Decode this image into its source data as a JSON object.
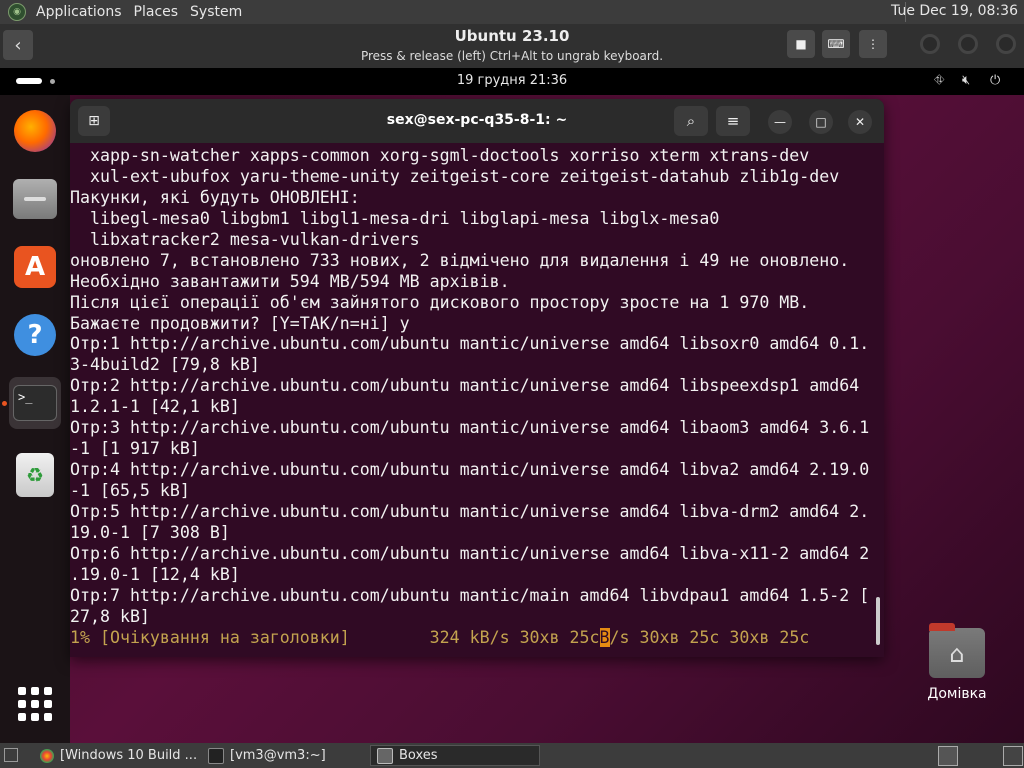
{
  "host": {
    "menus": [
      "Applications",
      "Places",
      "System"
    ],
    "clock": "Tue Dec 19, 08:36"
  },
  "boxes": {
    "title": "Ubuntu 23.10",
    "subtitle": "Press & release (left) Ctrl+Alt to ungrab keyboard."
  },
  "guest": {
    "clock": "19 грудня  21:36",
    "desktop_icon_label": "Домівка"
  },
  "terminal": {
    "title": "sex@sex-pc-q35-8-1: ~",
    "lines": [
      "  xapp-sn-watcher xapps-common xorg-sgml-doctools xorriso xterm xtrans-dev",
      "  xul-ext-ubufox yaru-theme-unity zeitgeist-core zeitgeist-datahub zlib1g-dev",
      "Пакунки, які будуть ОНОВЛЕНІ:",
      "  libegl-mesa0 libgbm1 libgl1-mesa-dri libglapi-mesa libglx-mesa0",
      "  libxatracker2 mesa-vulkan-drivers",
      "оновлено 7, встановлено 733 нових, 2 відмічено для видалення і 49 не оновлено.",
      "Необхідно завантажити 594 MB/594 MB архівів.",
      "Після цієї операції об'єм зайнятого дискового простору зросте на 1 970 MB.",
      "Бажаєте продовжити? [Y=ТАК/n=ні] y",
      "Отр:1 http://archive.ubuntu.com/ubuntu mantic/universe amd64 libsoxr0 amd64 0.1.",
      "3-4build2 [79,8 kB]",
      "Отр:2 http://archive.ubuntu.com/ubuntu mantic/universe amd64 libspeexdsp1 amd64",
      "1.2.1-1 [42,1 kB]",
      "Отр:3 http://archive.ubuntu.com/ubuntu mantic/universe amd64 libaom3 amd64 3.6.1",
      "-1 [1 917 kB]",
      "Отр:4 http://archive.ubuntu.com/ubuntu mantic/universe amd64 libva2 amd64 2.19.0",
      "-1 [65,5 kB]",
      "Отр:5 http://archive.ubuntu.com/ubuntu mantic/universe amd64 libva-drm2 amd64 2.",
      "19.0-1 [7 308 B]",
      "Отр:6 http://archive.ubuntu.com/ubuntu mantic/universe amd64 libva-x11-2 amd64 2",
      ".19.0-1 [12,4 kB]",
      "Отр:7 http://archive.ubuntu.com/ubuntu mantic/main amd64 libvdpau1 amd64 1.5-2 [",
      "27,8 kB]"
    ],
    "status_before_cursor": "1% [Очікування на заголовки]        324 kB/s 30хв 25с",
    "status_cursor_char": "B",
    "status_after_cursor": "/s 30хв 25с 30хв 25с"
  },
  "taskbar": {
    "tasks": [
      "[Windows 10 Build ...",
      "[vm3@vm3:~]",
      "Boxes"
    ]
  },
  "colors": {
    "terminal_bg": "#300a24",
    "accent": "#e95420",
    "status_text": "#c3a34f"
  }
}
